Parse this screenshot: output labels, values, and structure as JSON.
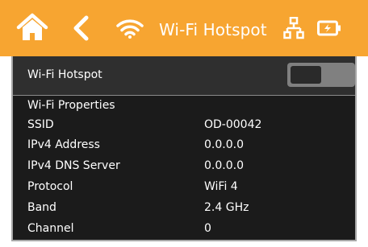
{
  "header": {
    "title": "Wi-Fi Hotspot",
    "background_color": "#f7a531",
    "icons": [
      "home-icon",
      "back-icon",
      "wifi-icon",
      "network-icon",
      "battery-icon"
    ]
  },
  "hotspot": {
    "label": "Wi-Fi Hotspot",
    "enabled": false
  },
  "properties": {
    "heading": "Wi-Fi Properties",
    "rows": [
      {
        "name": "SSID",
        "value": "OD-00042"
      },
      {
        "name": "IPv4 Address",
        "value": "0.0.0.0"
      },
      {
        "name": "IPv4 DNS Server",
        "value": "0.0.0.0"
      },
      {
        "name": "Protocol",
        "value": "WiFi 4"
      },
      {
        "name": "Band",
        "value": "2.4 GHz"
      },
      {
        "name": "Channel",
        "value": "0"
      }
    ]
  }
}
